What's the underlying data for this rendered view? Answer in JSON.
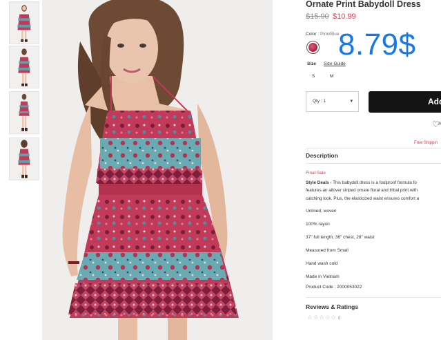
{
  "product": {
    "title": "Ornate Print Babydoll Dress",
    "price_original": "$15.90",
    "price_sale": "$10.99",
    "overlay_price": "8.79$"
  },
  "color": {
    "label": "Color",
    "selected": "Pink/Blue"
  },
  "size": {
    "label": "Size",
    "guide_label": "Size Guide",
    "options": [
      "S",
      "M"
    ]
  },
  "quantity": {
    "label": "Qty : 1"
  },
  "actions": {
    "add_label": "Add",
    "wishlist_label": "A",
    "free_shipping": "Free Shippin"
  },
  "description": {
    "heading": "Description",
    "final_sale": "Final Sale",
    "style_deals_label": "Style Deals -",
    "lines": [
      " This babydoll dress is a foolproof formula fo",
      "features an allover striped ornate floral and tribal print with",
      "catching look. Plus, the elasticized waist ensures comfort a"
    ],
    "bullets": [
      "Unlined, woven",
      "100% rayon",
      "37\" full length, 36\" chest, 28\" waist",
      "Measured from Small",
      "Hand wash cold",
      "Made in Vietnam",
      "Product Code : 2000053022"
    ]
  },
  "reviews": {
    "heading": "Reviews & Ratings",
    "stars": "☆☆☆☆☆",
    "count": "0"
  },
  "colors": {
    "accent_red": "#e8334a",
    "overlay_blue": "#1a78e5",
    "button_black": "#141414",
    "dress_pink": "#c23a5a",
    "dress_teal": "#5aa3ad"
  }
}
